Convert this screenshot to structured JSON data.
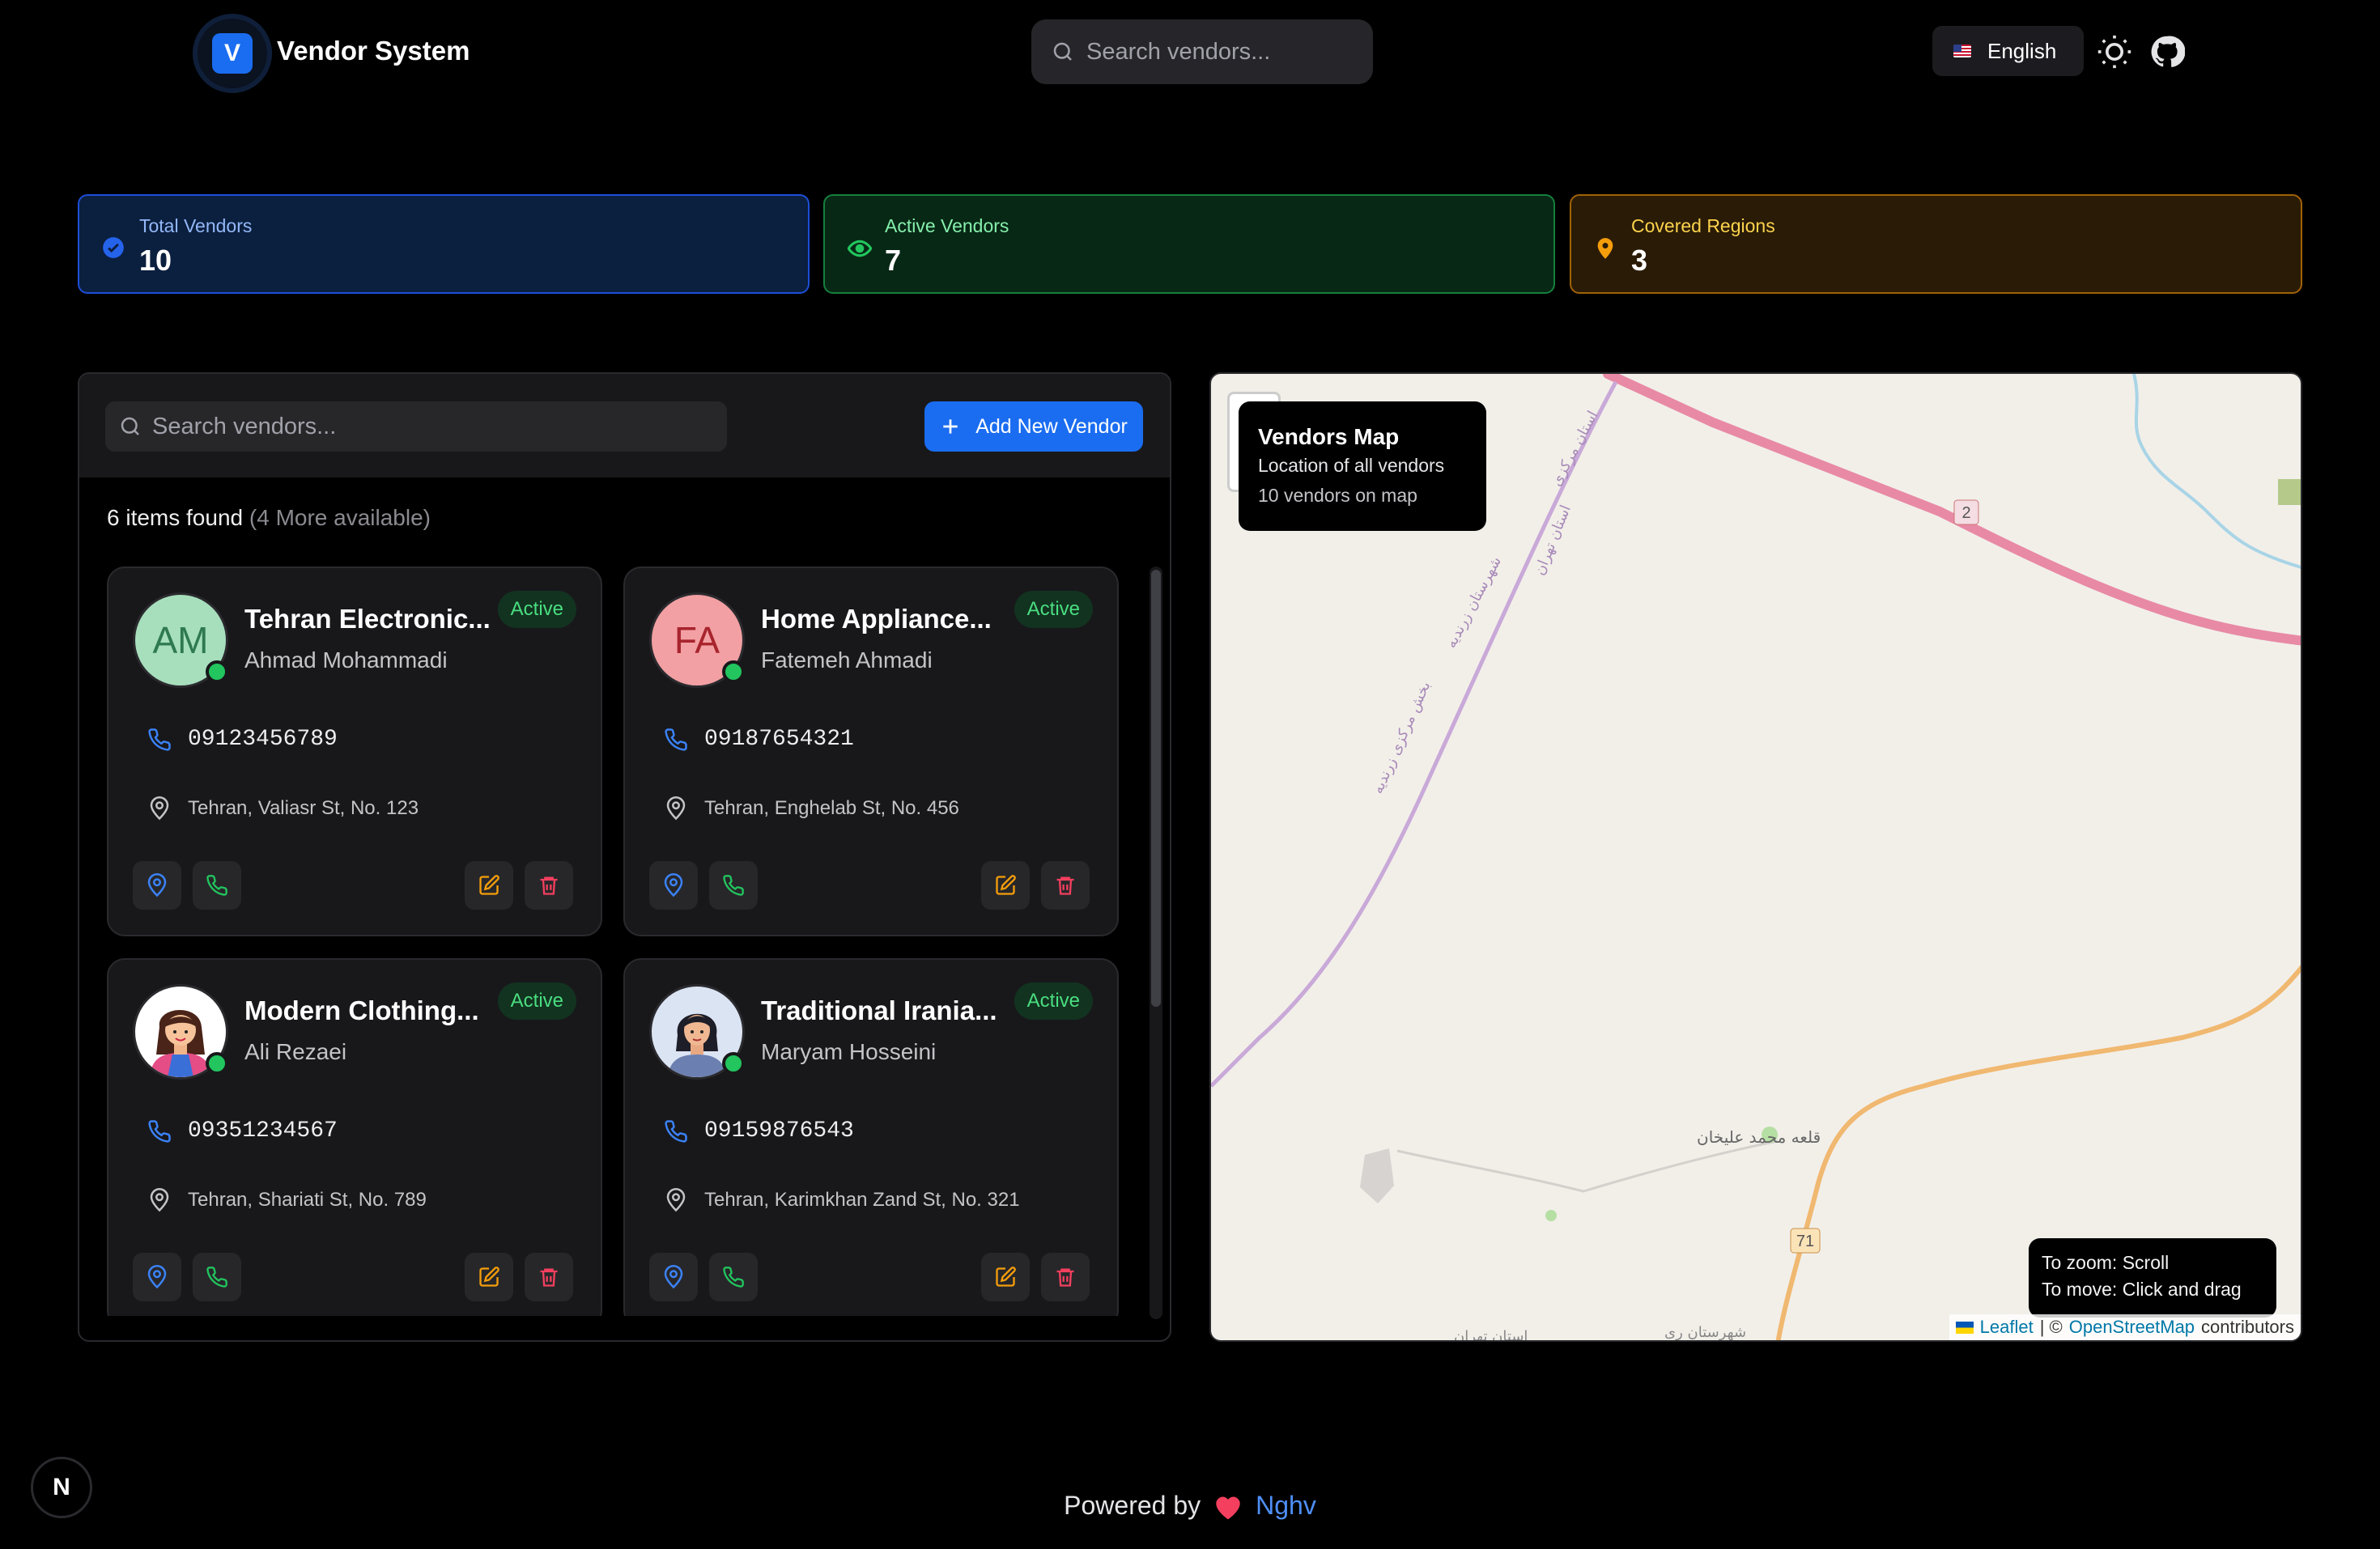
{
  "header": {
    "logo_letter": "V",
    "brand": "Vendor System",
    "search_placeholder": "Search vendors...",
    "language": "English",
    "icons": [
      "search-icon",
      "us-flag-icon",
      "sun-icon",
      "github-icon"
    ]
  },
  "stats": [
    {
      "label": "Total Vendors",
      "value": "10",
      "color": "#1d4ed8",
      "icon": "check-circle-icon"
    },
    {
      "label": "Active Vendors",
      "value": "7",
      "color": "#15803d",
      "icon": "eye-icon"
    },
    {
      "label": "Covered Regions",
      "value": "3",
      "color": "#a16207",
      "icon": "map-pin-icon"
    }
  ],
  "list": {
    "search_placeholder": "Search vendors...",
    "add_button": "Add New Vendor",
    "count_text": "6 items found",
    "more_text": "(4 More available)"
  },
  "vendors": [
    {
      "name": "Tehran Electronic...",
      "owner": "Ahmad Mohammadi",
      "initials": "AM",
      "avatar_bg": "#a7dfbd",
      "avatar_fg": "#2f7a50",
      "status": "Active",
      "phone": "09123456789",
      "address": "Tehran, Valiasr St, No. 123"
    },
    {
      "name": "Home Appliance...",
      "owner": "Fatemeh Ahmadi",
      "initials": "FA",
      "avatar_bg": "#f2a0a3",
      "avatar_fg": "#a8242d",
      "status": "Active",
      "phone": "09187654321",
      "address": "Tehran, Enghelab St, No. 456"
    },
    {
      "name": "Modern Clothing...",
      "owner": "Ali Rezaei",
      "initials": "",
      "avatar_bg": "#ffffff",
      "avatar_fg": "#000000",
      "status": "Active",
      "phone": "09351234567",
      "address": "Tehran, Shariati St, No. 789"
    },
    {
      "name": "Traditional Irania...",
      "owner": "Maryam Hosseini",
      "initials": "",
      "avatar_bg": "#dbe4f3",
      "avatar_fg": "#000000",
      "status": "Active",
      "phone": "09159876543",
      "address": "Tehran, Karimkhan Zand St, No. 321"
    }
  ],
  "map": {
    "title": "Vendors Map",
    "subtitle": "Location of all vendors",
    "count": "10 vendors on map",
    "hint_zoom": "To zoom: Scroll",
    "hint_move": "To move: Click and drag",
    "attr_leaflet": "Leaflet",
    "attr_sep": "| ©",
    "attr_osm": "OpenStreetMap",
    "attr_tail": "contributors",
    "labels": [
      "استان مرکزی",
      "استان تهران",
      "شهرستان زرندیه",
      "بخش مرکزی زرندیه",
      "قلعه محمد علیخان",
      "استان تهران",
      "شهرستان ری"
    ],
    "road_shields": [
      "2",
      "71"
    ]
  },
  "footer": {
    "prefix": "Powered by",
    "who": "Nghv",
    "corner_badge": "N"
  }
}
